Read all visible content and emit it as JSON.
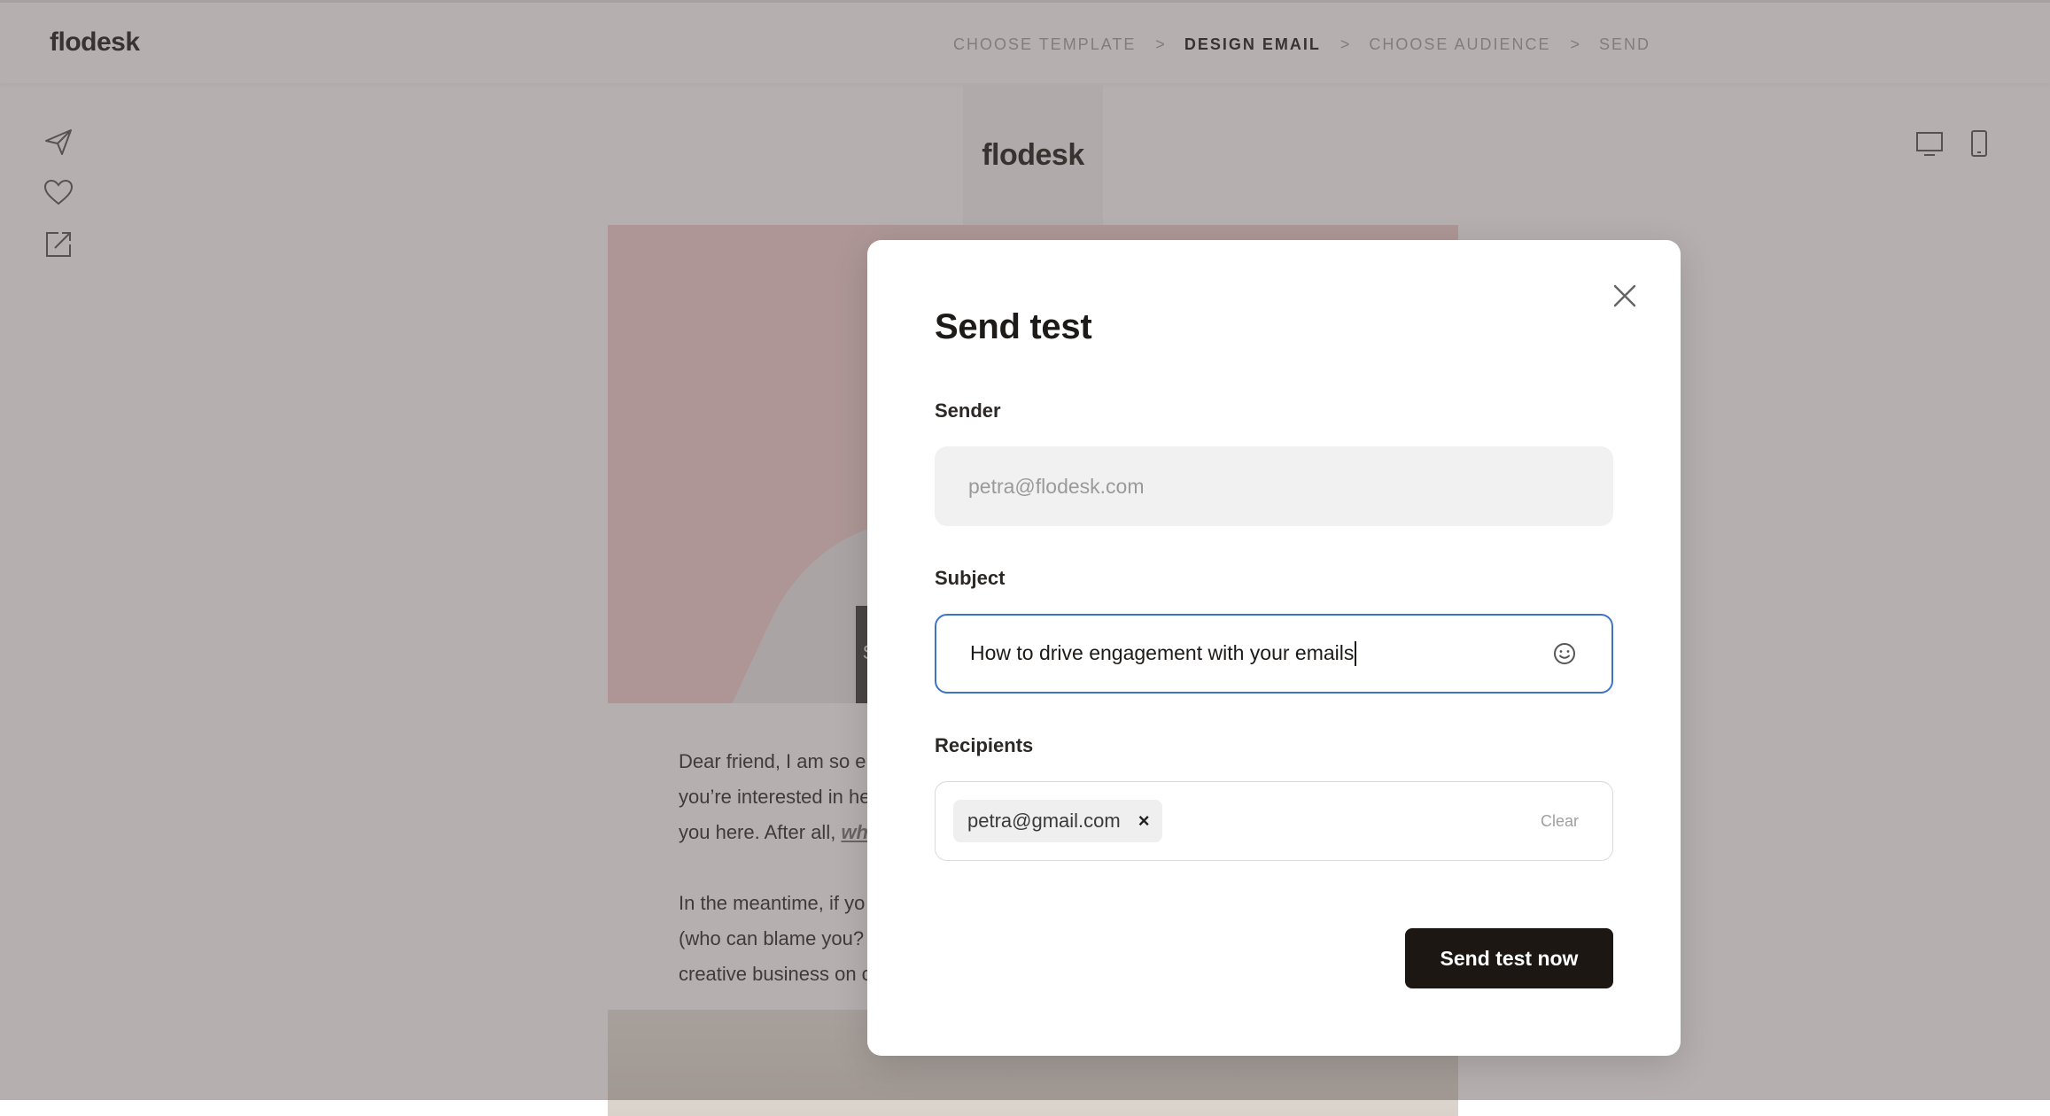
{
  "app": {
    "logo": "flodesk"
  },
  "steps": [
    {
      "label": "CHOOSE TEMPLATE",
      "active": false
    },
    {
      "label": "DESIGN EMAIL",
      "active": true
    },
    {
      "label": "CHOOSE AUDIENCE",
      "active": false
    },
    {
      "label": "SEND",
      "active": false
    }
  ],
  "step_separator": ">",
  "toolbar_icons": [
    "send-icon",
    "heart-icon",
    "external-link-icon"
  ],
  "view_icons": [
    "desktop-icon",
    "mobile-icon"
  ],
  "email": {
    "logo": "flodesk",
    "hero_badge": "S",
    "paragraph1": {
      "lines": [
        "Dear friend, I am so e",
        "you’re interested in he",
        "you here. After all, "
      ],
      "link": "wh"
    },
    "paragraph2": {
      "lines": [
        "In the meantime, if yo",
        "(who can blame you?",
        "creative business on c"
      ]
    }
  },
  "modal": {
    "title": "Send test",
    "sender": {
      "label": "Sender",
      "value": "petra@flodesk.com"
    },
    "subject": {
      "label": "Subject",
      "value": "How to drive engagement with your emails"
    },
    "recipients": {
      "label": "Recipients",
      "chips": [
        "petra@gmail.com"
      ],
      "chip_remove": "×",
      "clear_label": "Clear"
    },
    "send_button": "Send test now"
  },
  "colors": {
    "brand_dark": "#1d1714",
    "focus_blue": "#3f73c9",
    "hero_pink": "#f3cfd2",
    "overlay": "rgba(90,80,78,0.45)"
  }
}
